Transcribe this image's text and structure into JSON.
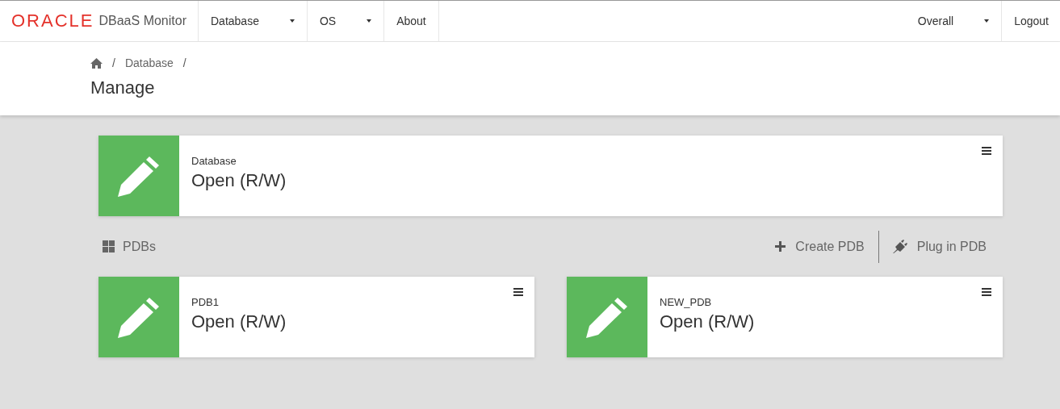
{
  "navbar": {
    "logo": "ORACLE",
    "product": "DBaaS Monitor",
    "menu": [
      {
        "label": "Database",
        "dropdown": true
      },
      {
        "label": "OS",
        "dropdown": true
      },
      {
        "label": "About",
        "dropdown": false
      }
    ],
    "right_menu": [
      {
        "label": "Overall",
        "dropdown": true
      },
      {
        "label": "Logout",
        "dropdown": false
      }
    ]
  },
  "breadcrumb": [
    {
      "kind": "separator",
      "text": "/"
    },
    {
      "kind": "link",
      "text": "Database"
    },
    {
      "kind": "separator",
      "text": "/"
    }
  ],
  "title": "Manage",
  "database_card": {
    "label": "Database",
    "status": "Open (R/W)"
  },
  "pdbs": {
    "heading": "PDBs",
    "actions": [
      {
        "kind": "create",
        "label": "Create PDB"
      },
      {
        "kind": "plug",
        "label": "Plug in PDB"
      }
    ],
    "cards": [
      {
        "label": "PDB1",
        "status": "Open (R/W)"
      },
      {
        "label": "NEW_PDB",
        "status": "Open (R/W)"
      }
    ]
  }
}
